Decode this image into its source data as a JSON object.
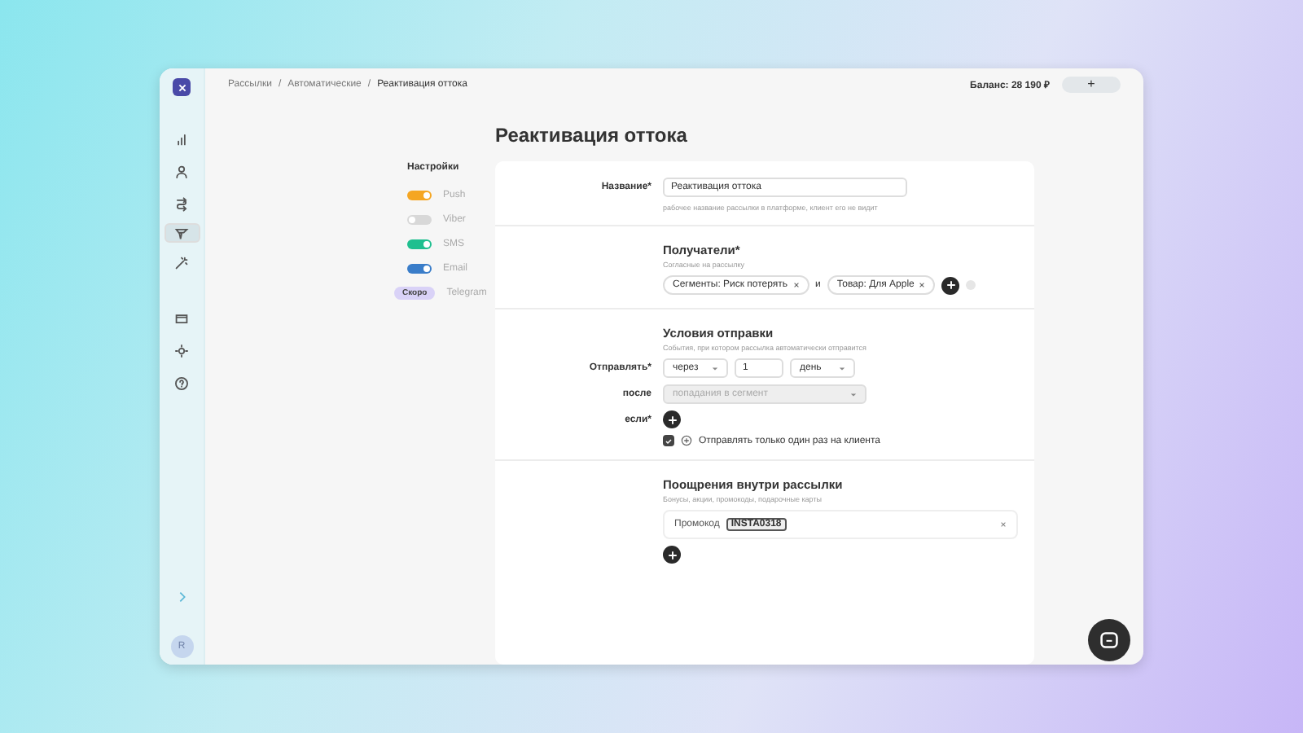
{
  "sidebar": {
    "items": [
      {
        "selected": false
      },
      {
        "selected": false
      },
      {
        "selected": false
      },
      {
        "selected": true
      },
      {
        "selected": false
      },
      {
        "selected": false
      },
      {
        "selected": false
      },
      {
        "selected": false
      }
    ],
    "avatar": "R"
  },
  "breadcrumbs": [
    "Рассылки",
    "Автоматические",
    "Реактивация оттока"
  ],
  "breadcrumb_separator": "/",
  "balance": "Баланс: 28 190 ₽",
  "add_button": "+",
  "title": "Реактивация оттока",
  "settings": {
    "heading": "Настройки",
    "channels": [
      {
        "kind": "toggle",
        "label": "Push",
        "on": true,
        "color": "#f5a623"
      },
      {
        "kind": "toggle",
        "label": "Viber",
        "on": false,
        "color": "#d8d8d8"
      },
      {
        "kind": "toggle",
        "label": "SMS",
        "on": true,
        "color": "#1fbf8f"
      },
      {
        "kind": "toggle",
        "label": "Email",
        "on": true,
        "color": "#3a7dc9"
      },
      {
        "kind": "badge",
        "label": "Telegram",
        "badge": "Скоро",
        "color": "#d9d2f7"
      }
    ]
  },
  "name_section": {
    "label": "Название*",
    "value": "Реактивация оттока",
    "hint": "рабочее название рассылки в платформе, клиент его не видит"
  },
  "recipients": {
    "title": "Получатели*",
    "subtitle": "Согласные на рассылку",
    "chips": [
      "Сегменты: Риск потерять",
      "Товар: Для Apple"
    ],
    "joiner": "и"
  },
  "conditions": {
    "title": "Условия отправки",
    "subtitle": "События, при котором рассылка автоматически отправится",
    "send_label": "Отправлять*",
    "when": "через",
    "amount": "1",
    "unit": "день",
    "after_label": "после",
    "after": {
      "value": "попадания в сегмент",
      "disabled": true
    },
    "if_label": "если*",
    "once": {
      "label": "Отправлять только один раз на клиента",
      "checked": true
    }
  },
  "rewards": {
    "title": "Поощрения внутри рассылки",
    "subtitle": "Бонусы, акции, промокоды, подарочные карты",
    "items": [
      {
        "label": "Промокод",
        "code": "INSTA0318"
      }
    ]
  }
}
